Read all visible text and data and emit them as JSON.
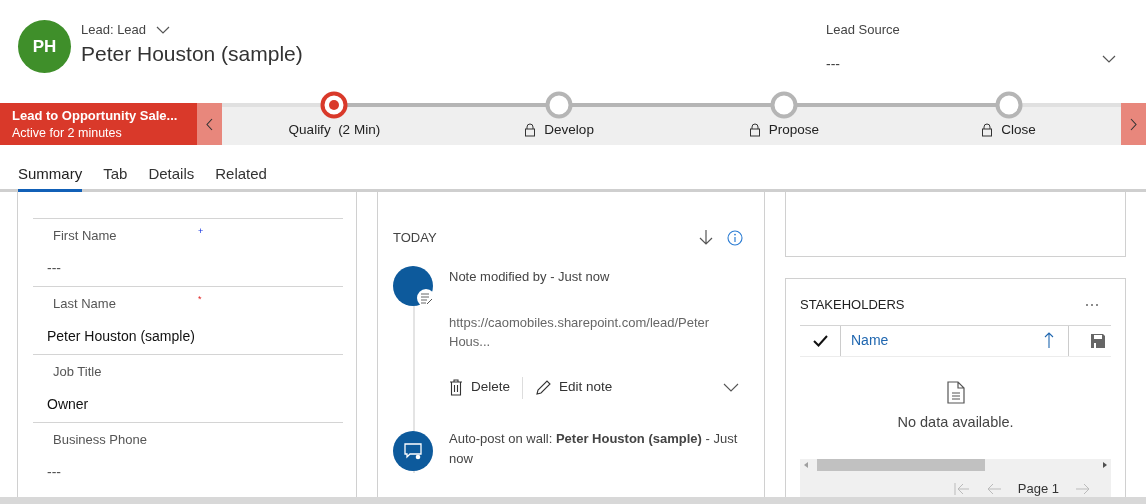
{
  "header": {
    "avatar_initials": "PH",
    "entity": "Lead: Lead",
    "title": "Peter Houston (sample)",
    "field": {
      "label": "Lead Source",
      "value": "---"
    }
  },
  "process": {
    "name": "Lead to Opportunity Sale...",
    "status": "Active for 2 minutes",
    "stages": [
      {
        "label": "Qualify  (2 Min)",
        "active": true,
        "locked": false
      },
      {
        "label": "Develop",
        "active": false,
        "locked": true
      },
      {
        "label": "Propose",
        "active": false,
        "locked": true
      },
      {
        "label": "Close",
        "active": false,
        "locked": true
      }
    ]
  },
  "tabs": [
    {
      "label": "Summary",
      "selected": true
    },
    {
      "label": "Tab",
      "selected": false
    },
    {
      "label": "Details",
      "selected": false
    },
    {
      "label": "Related",
      "selected": false
    }
  ],
  "fields": [
    {
      "label": "First Name",
      "required": false,
      "marker": "+",
      "value": "---",
      "empty": true
    },
    {
      "label": "Last Name",
      "required": true,
      "marker": "*",
      "value": "Peter Houston (sample)",
      "empty": false
    },
    {
      "label": "Job Title",
      "value": "Owner",
      "empty": false
    },
    {
      "label": "Business Phone",
      "value": "---",
      "empty": true
    }
  ],
  "timeline": {
    "heading": "TODAY",
    "items": [
      {
        "kind": "note",
        "title": "Note modified by  -  Just now",
        "body": "https://caomobiles.sharepoint.com/lead/Peter Hous...",
        "actions": [
          "Delete",
          "Edit note"
        ],
        "expanded": false
      },
      {
        "kind": "post",
        "title": "Auto-post on wall:  **Peter Houston (sample)** -  Just now"
      }
    ]
  },
  "stakeholders": {
    "title": "STAKEHOLDERS",
    "select_all_checked": true,
    "columns": [
      {
        "label": "Name"
      }
    ],
    "empty_message": "No data available.",
    "page": "Page 1"
  }
}
